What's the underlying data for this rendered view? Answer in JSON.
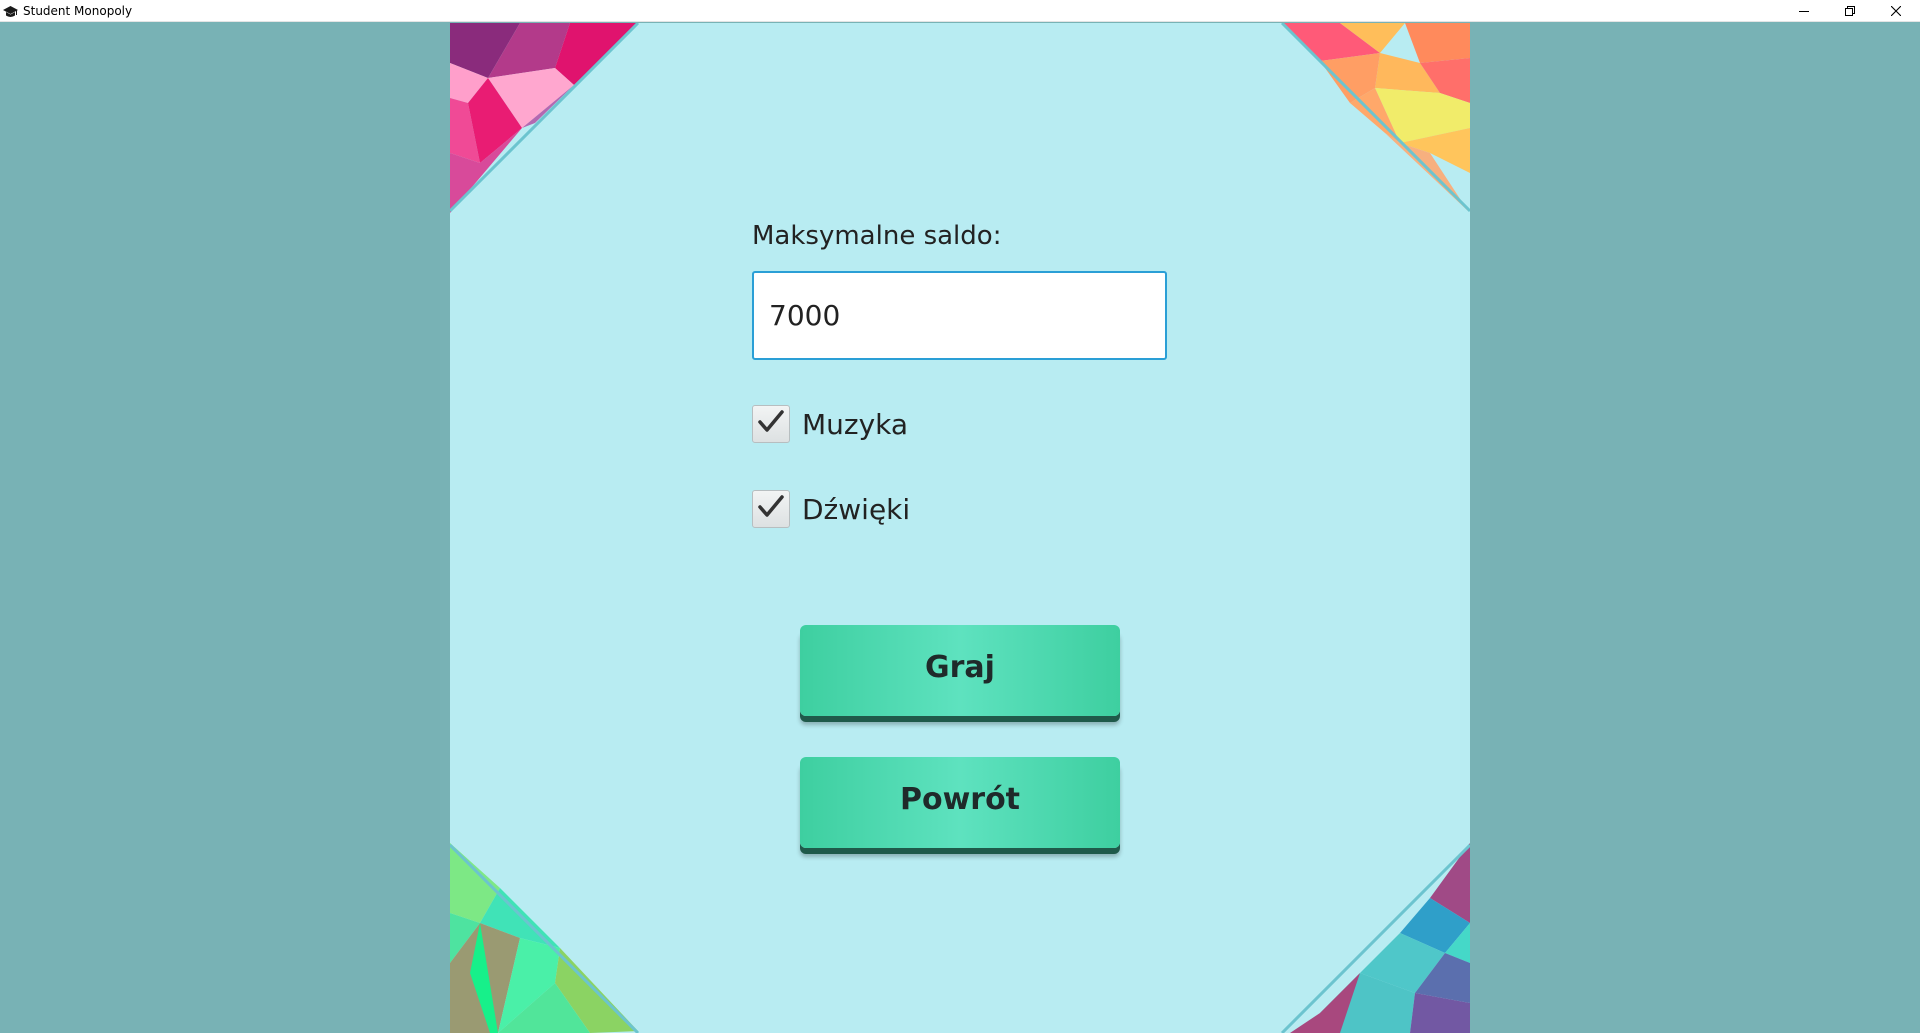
{
  "window": {
    "title": "Student Monopoly",
    "icon": "graduation-cap-icon",
    "controls": {
      "minimize": "minimize-icon",
      "restore": "restore-icon",
      "close": "close-icon"
    }
  },
  "settings": {
    "balance_label": "Maksymalne saldo:",
    "balance_value": "7000",
    "music": {
      "label": "Muzyka",
      "checked": true
    },
    "sounds": {
      "label": "Dźwięki",
      "checked": true
    }
  },
  "buttons": {
    "play_label": "Graj",
    "back_label": "Powrót"
  },
  "colors": {
    "background": "#78b2b5",
    "panel": "#b8ecf2",
    "button": "#4fd9b0",
    "input_border": "#2a9fd6"
  }
}
